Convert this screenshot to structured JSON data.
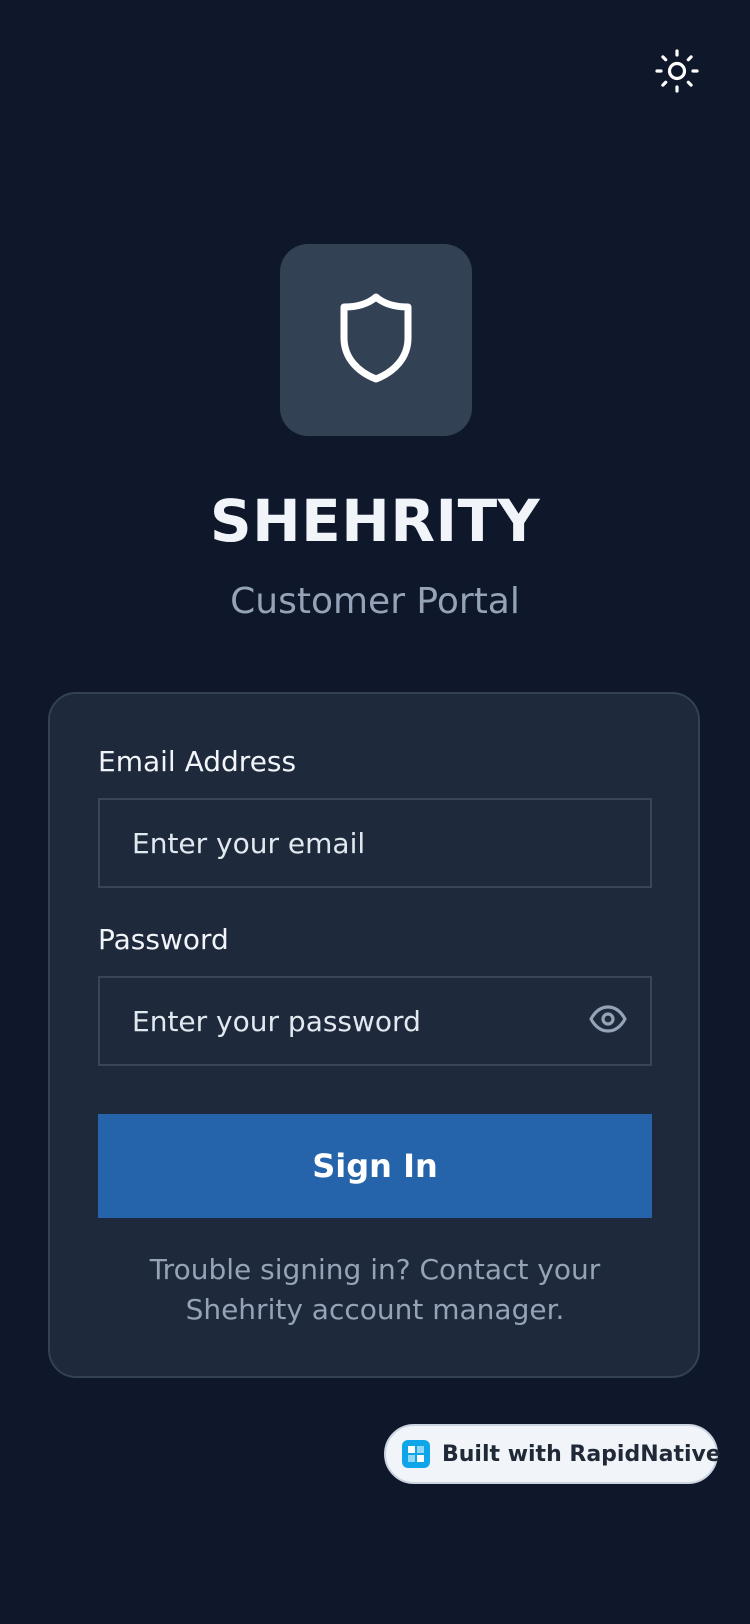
{
  "theme_toggle": {
    "icon": "sun-icon"
  },
  "logo": {
    "icon": "shield-icon",
    "tile_color": "#334155"
  },
  "brand": {
    "title": "SHEHRITY",
    "subtitle": "Customer Portal"
  },
  "form": {
    "email": {
      "label": "Email Address",
      "placeholder": "Enter your email",
      "value": ""
    },
    "password": {
      "label": "Password",
      "placeholder": "Enter your password",
      "value": "",
      "toggle_icon": "eye-icon"
    },
    "submit_label": "Sign In",
    "help_text": "Trouble signing in? Contact your Shehrity account manager."
  },
  "badge": {
    "label": "Built with RapidNative",
    "icon": "rapidnative-logo-icon"
  },
  "colors": {
    "background": "#0f172a",
    "card": "#1e293b",
    "accent": "#2563ab",
    "muted_text": "#94a3b8"
  }
}
